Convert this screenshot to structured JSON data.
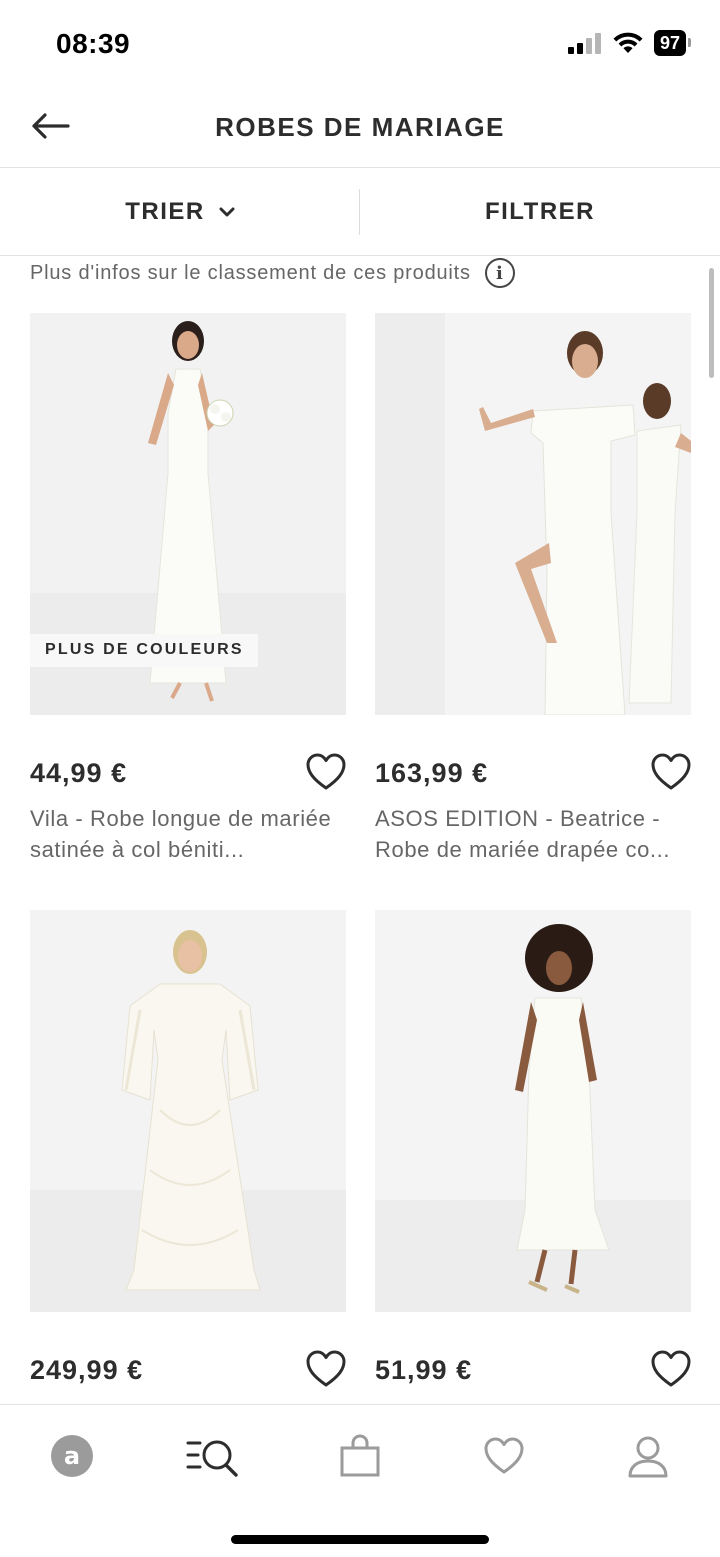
{
  "status": {
    "time": "08:39",
    "battery": "97"
  },
  "header": {
    "title": "ROBES DE MARIAGE"
  },
  "toolbar": {
    "sort_label": "TRIER",
    "filter_label": "FILTRER"
  },
  "info": {
    "text": "Plus d'infos sur le classement de ces produits",
    "icon_glyph": "i"
  },
  "products": [
    {
      "price": "44,99 €",
      "name": "Vila - Robe longue de mariée satinée à col béniti...",
      "badge": "PLUS DE COULEURS"
    },
    {
      "price": "163,99 €",
      "name": "ASOS EDITION - Beatrice - Robe de mariée drapée co..."
    },
    {
      "price": "249,99 €",
      "name": ""
    },
    {
      "price": "51,99 €",
      "name": ""
    }
  ],
  "nav": {
    "items": [
      "home-icon",
      "search-icon",
      "bag-icon",
      "saved-icon",
      "account-icon"
    ],
    "home_glyph": "a"
  },
  "colors": {
    "text_primary": "#2d2d2d",
    "text_secondary": "#666666",
    "nav_icon": "#8a8a8a",
    "divider": "#e2e2e2"
  }
}
